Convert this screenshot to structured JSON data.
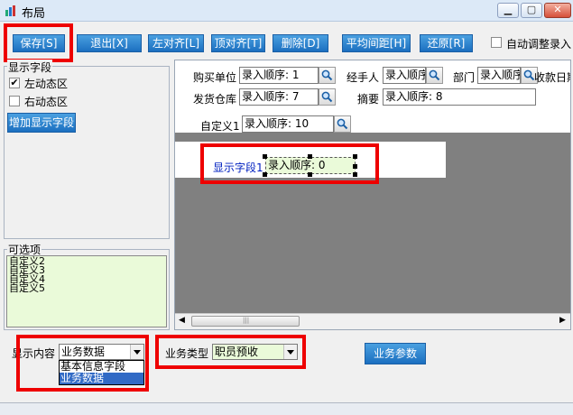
{
  "window": {
    "title": "布局",
    "minimize_icon": "minimize-icon",
    "maximize_icon": "maximize-icon",
    "close_icon": "close-icon"
  },
  "toolbar": {
    "save": "保存[S]",
    "exit": "退出[X]",
    "align_left": "左对齐[L]",
    "align_top": "顶对齐[T]",
    "delete": "删除[D]",
    "avg_spacing": "平均间距[H]",
    "restore": "还原[R]",
    "auto_adjust": "自动调整录入"
  },
  "display_fields": {
    "legend": "显示字段",
    "left_zone": "左动态区",
    "right_zone": "右动态区",
    "left_checked": true,
    "right_checked": false,
    "add_button": "增加显示字段"
  },
  "optional": {
    "legend": "可选项",
    "items": [
      "自定义2",
      "自定义3",
      "自定义4",
      "自定义5"
    ]
  },
  "form": {
    "buyer_label": "购买单位",
    "buyer_value": "录入顺序: 1",
    "handler_label": "经手人",
    "handler_value": "录入顺序",
    "dept_label": "部门",
    "dept_value": "录入顺序",
    "pay_date_label": "收款日期",
    "warehouse_label": "发货仓库",
    "warehouse_value": "录入顺序: 7",
    "summary_label": "摘要",
    "summary_value": "录入顺序: 8",
    "custom1_label": "自定义1",
    "custom1_value": "录入顺序: 10"
  },
  "detail": {
    "field_label": "显示字段1",
    "field_value": "录入顺序: 0"
  },
  "bottom": {
    "content_label": "显示内容",
    "content_value": "业务数据",
    "content_options": [
      "基本信息字段",
      "业务数据"
    ],
    "biz_type_label": "业务类型",
    "biz_type_value": "职员预收",
    "biz_params": "业务参数"
  }
}
